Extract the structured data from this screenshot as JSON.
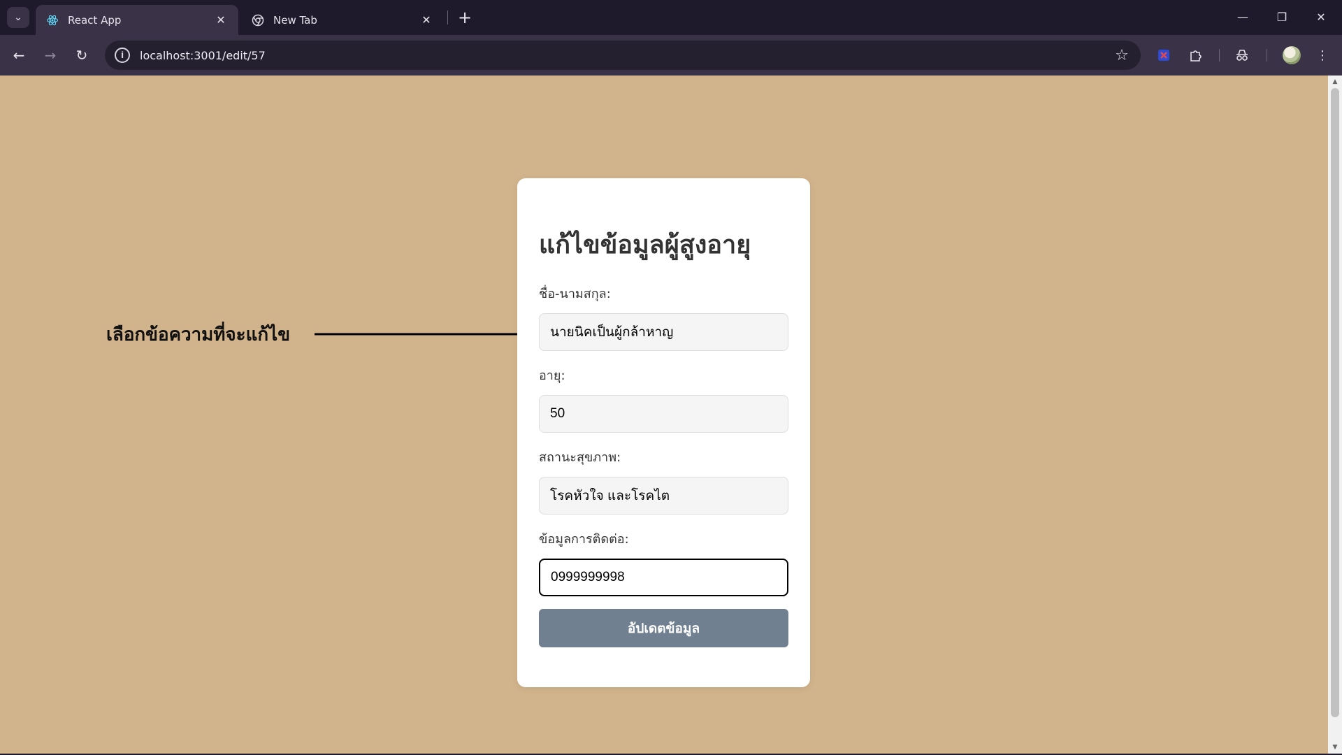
{
  "browser": {
    "tabs": [
      {
        "title": "React App",
        "active": true
      },
      {
        "title": "New Tab",
        "active": false
      }
    ],
    "url": "localhost:3001/edit/57",
    "icons": [
      "tab-search-icon",
      "react-favicon",
      "chrome-favicon",
      "close-icon",
      "plus-icon",
      "minimize-icon",
      "restore-icon",
      "close-window-icon",
      "back-icon",
      "forward-icon",
      "reload-icon",
      "info-icon",
      "star-icon",
      "extension-icon",
      "puzzle-icon",
      "incognito-icon",
      "menu-icon"
    ]
  },
  "page": {
    "background_color": "#d2b48c",
    "form": {
      "title": "แก้ไขข้อมูลผู้สูงอายุ",
      "fields": [
        {
          "label": "ชื่อ-นามสกุล:",
          "value": "นายนิคเป็นผู้กล้าหาญ"
        },
        {
          "label": "อายุ:",
          "value": "50"
        },
        {
          "label": "สถานะสุขภาพ:",
          "value": "โรคหัวใจ และโรคไต"
        },
        {
          "label": "ข้อมูลการติดต่อ:",
          "value": "0999999998"
        }
      ],
      "submit_label": "อัปเดตข้อมูล",
      "button_color": "#708090"
    },
    "annotation": {
      "text": "เลือกข้อความที่จะแก้ไข"
    }
  }
}
